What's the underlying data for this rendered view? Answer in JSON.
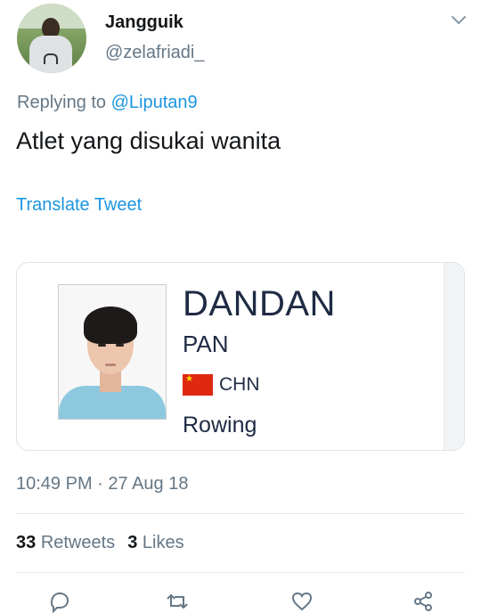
{
  "author": {
    "name": "Jangguik",
    "handle": "@zelafriadi_"
  },
  "reply": {
    "prefix": "Replying to",
    "mention": "@Liputan9"
  },
  "tweet": {
    "text": "Atlet yang disukai wanita",
    "translate": "Translate Tweet"
  },
  "card": {
    "first_name": "DANDAN",
    "last_name": "PAN",
    "country": "CHN",
    "sport": "Rowing",
    "flag_color": "#de2910"
  },
  "meta": {
    "timestamp": "10:49 PM · 27 Aug 18"
  },
  "stats": {
    "retweets_count": "33",
    "retweets_label": "Retweets",
    "likes_count": "3",
    "likes_label": "Likes"
  },
  "icons": [
    "chevron-down-icon",
    "reply-icon",
    "retweet-icon",
    "like-icon",
    "share-icon"
  ],
  "colors": {
    "link": "#1b95e0",
    "muted": "#657786",
    "text": "#14171a"
  }
}
